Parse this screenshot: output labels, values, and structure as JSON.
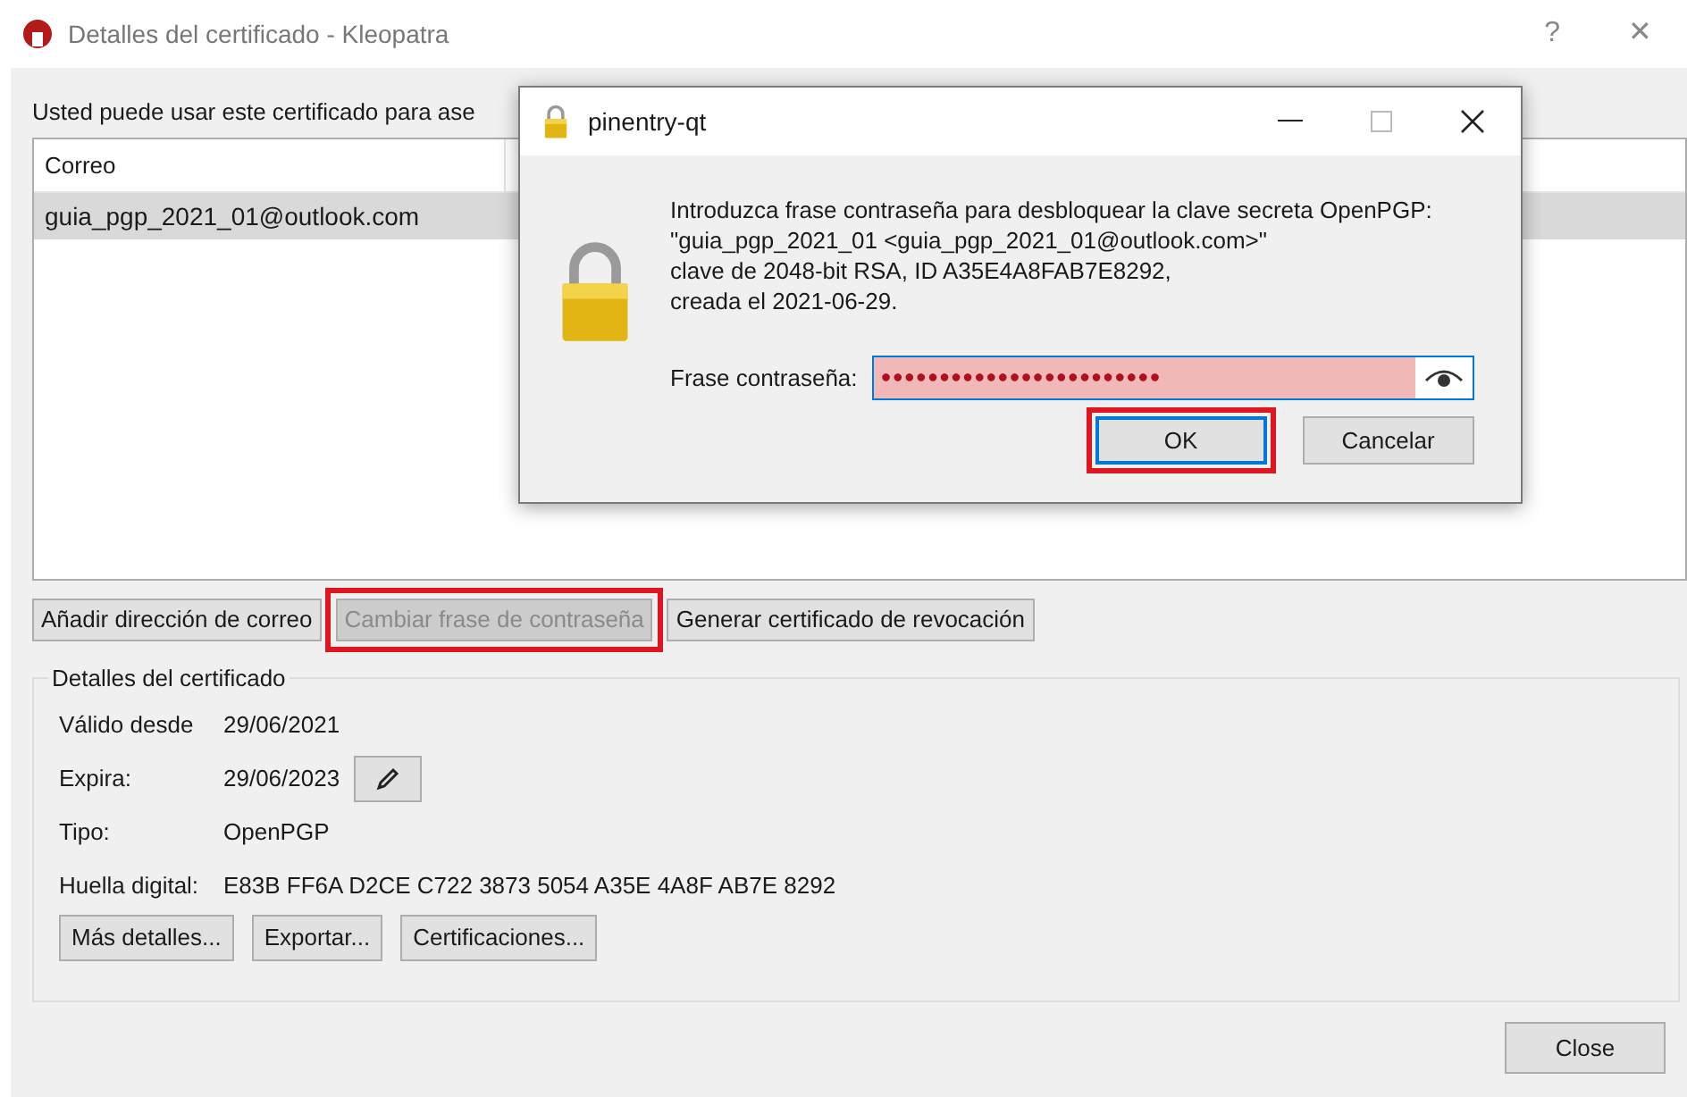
{
  "window": {
    "title": "Detalles del certificado - Kleopatra",
    "controls": [
      "?",
      "✕"
    ]
  },
  "intro": "Usted puede usar este certificado para ase",
  "table": {
    "columns": [
      "Correo"
    ],
    "rows": [
      {
        "cells": [
          "guia_pgp_2021_01@outlook.com"
        ],
        "selected": true
      }
    ]
  },
  "actions": [
    {
      "label": "Añadir dirección de correo",
      "disabled": false,
      "highlighted": false
    },
    {
      "label": "Cambiar frase de contraseña",
      "disabled": true,
      "highlighted": true
    },
    {
      "label": "Generar certificado de revocación",
      "disabled": false,
      "highlighted": false
    }
  ],
  "details": {
    "title": "Detalles del certificado",
    "fields": [
      {
        "label": "Válido desde",
        "value": "29/06/2021",
        "kind": "text"
      },
      {
        "label": "Expira:",
        "value": "29/06/2023",
        "kind": "editable"
      },
      {
        "label": "Tipo:",
        "value": "OpenPGP",
        "kind": "text"
      },
      {
        "label": "Huella digital:",
        "value": "E83B FF6A D2CE C722 3873 5054 A35E 4A8F AB7E 8292",
        "kind": "text"
      }
    ],
    "buttons": [
      "Más detalles...",
      "Exportar...",
      "Certificaciones..."
    ]
  },
  "close_button": "Close",
  "dialog": {
    "title": "pinentry-qt",
    "message": [
      "Introduzca frase contraseña para desbloquear la clave secreta OpenPGP:",
      "\"guia_pgp_2021_01 <guia_pgp_2021_01@outlook.com>\"",
      "clave de 2048-bit RSA, ID A35E4A8FAB7E8292,",
      "creada el 2021-06-29."
    ],
    "field_label": "Frase contraseña:",
    "value": "●●●●●●●●●●●●●●●●●●●●●●●●",
    "invalid": true,
    "buttons": [
      {
        "label": "OK",
        "default": true,
        "highlighted": true
      },
      {
        "label": "Cancelar",
        "default": false,
        "highlighted": false
      }
    ]
  }
}
